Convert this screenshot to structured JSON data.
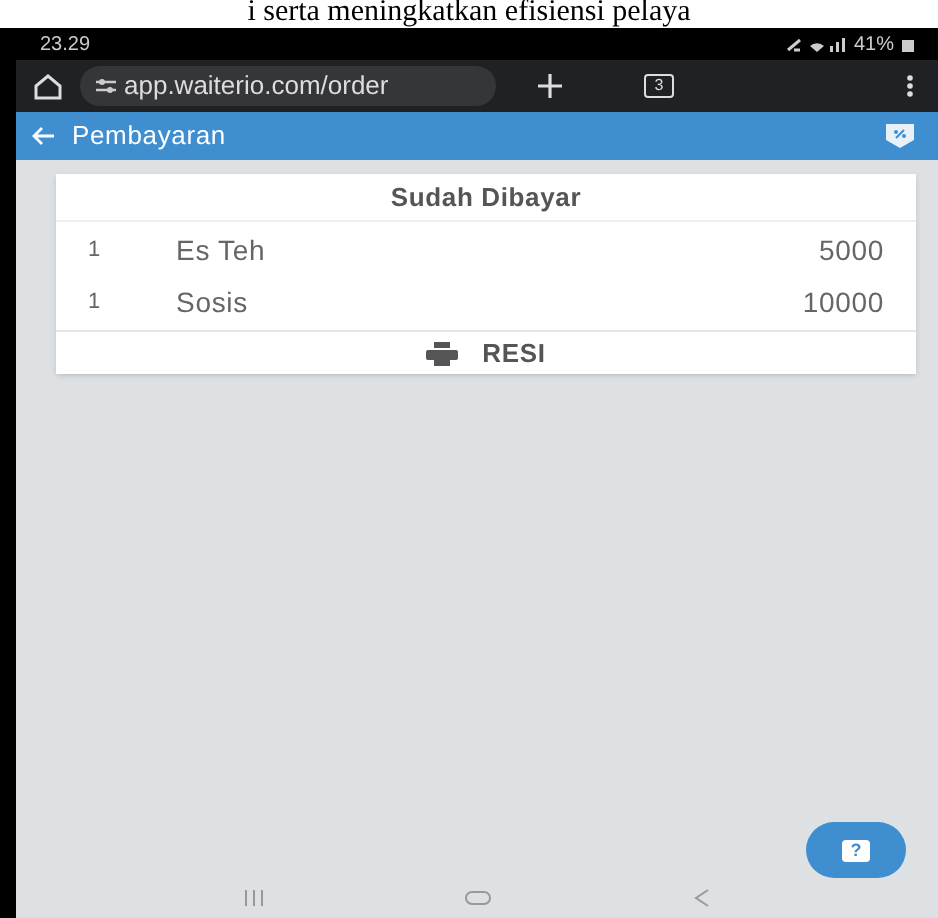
{
  "document_text": "i serta meningkatkan efisiensi pelaya",
  "status_bar": {
    "time": "23.29",
    "battery": "41%"
  },
  "browser": {
    "url": "app.waiterio.com/order",
    "tab_count": "3"
  },
  "app_bar": {
    "title": "Pembayaran"
  },
  "card": {
    "title": "Sudah Dibayar",
    "items": [
      {
        "qty": "1",
        "name": "Es Teh",
        "price": "5000"
      },
      {
        "qty": "1",
        "name": "Sosis",
        "price": "10000"
      }
    ],
    "receipt_button": "RESI"
  },
  "help_button": {
    "label": "?"
  }
}
